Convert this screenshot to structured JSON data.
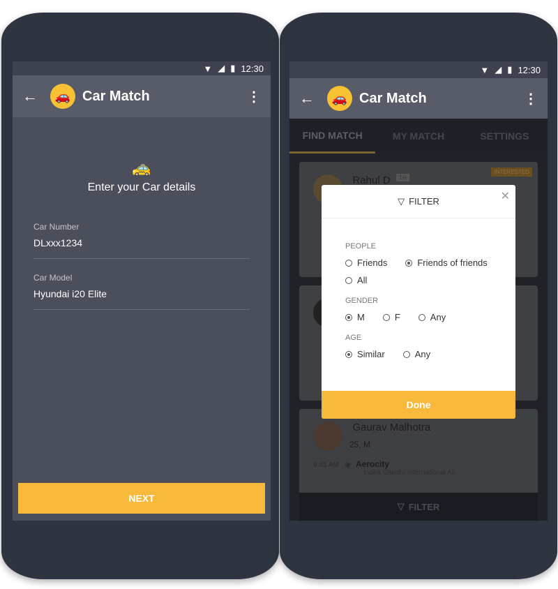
{
  "status": {
    "time": "12:30",
    "icons": [
      "wifi-icon",
      "signal-icon",
      "battery-icon"
    ]
  },
  "app": {
    "title": "Car Match",
    "back_icon": "arrow-left-icon",
    "more_icon": "more-vertical-icon"
  },
  "car_form": {
    "icon": "car-icon",
    "heading": "Enter your Car details",
    "fields": [
      {
        "label": "Car Number",
        "value": "DLxxx1234"
      },
      {
        "label": "Car Model",
        "value": "Hyundai i20 Elite"
      }
    ],
    "next_label": "NEXT"
  },
  "tabs": [
    {
      "label": "FIND MATCH",
      "active": true
    },
    {
      "label": "MY MATCH"
    },
    {
      "label": "SETTINGS"
    }
  ],
  "cards": [
    {
      "name": "Rahul D",
      "degree": "1st",
      "badge": "INTERESTED"
    },
    {
      "name": "",
      "sub": ""
    },
    {
      "name": "Gaurav Malhotra",
      "sub": "25, M",
      "time": "9:45 AM",
      "place": "Aerocity",
      "address": "Indira Gandhi International Air.."
    }
  ],
  "bottom_filter": "FILTER",
  "filter": {
    "title": "FILTER",
    "done_label": "Done",
    "sections": [
      {
        "label": "PEOPLE",
        "options": [
          {
            "label": "Friends",
            "selected": false
          },
          {
            "label": "Friends of friends",
            "selected": true
          },
          {
            "label": "All",
            "selected": false
          }
        ]
      },
      {
        "label": "GENDER",
        "options": [
          {
            "label": "M",
            "selected": true
          },
          {
            "label": "F",
            "selected": false
          },
          {
            "label": "Any",
            "selected": false
          }
        ]
      },
      {
        "label": "AGE",
        "options": [
          {
            "label": "Similar",
            "selected": true
          },
          {
            "label": "Any",
            "selected": false
          }
        ]
      }
    ]
  },
  "colors": {
    "accent": "#f6b93b",
    "appbar": "#585b68",
    "background": "#4b4f5c"
  }
}
